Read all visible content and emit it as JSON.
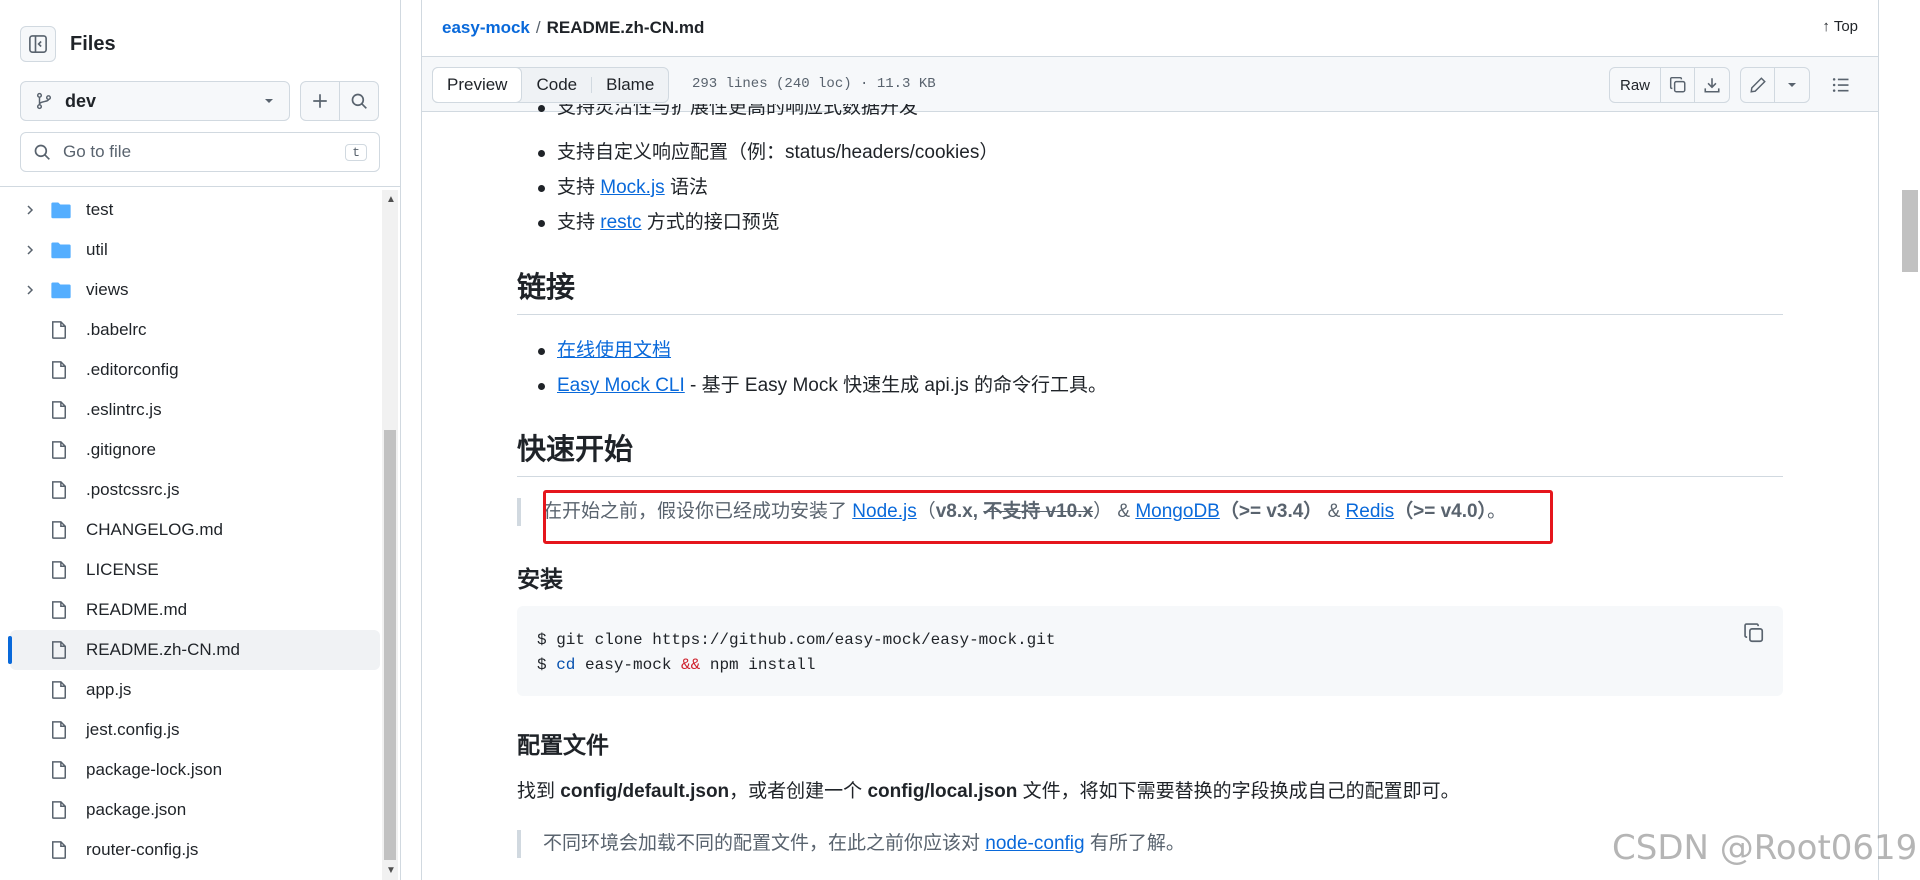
{
  "sidebar": {
    "title": "Files",
    "branch": "dev",
    "goto_placeholder": "Go to file",
    "goto_shortcut": "t",
    "folders": [
      {
        "label": "test"
      },
      {
        "label": "util"
      },
      {
        "label": "views"
      }
    ],
    "files": [
      {
        "label": ".babelrc"
      },
      {
        "label": ".editorconfig"
      },
      {
        "label": ".eslintrc.js"
      },
      {
        "label": ".gitignore"
      },
      {
        "label": ".postcssrc.js"
      },
      {
        "label": "CHANGELOG.md"
      },
      {
        "label": "LICENSE"
      },
      {
        "label": "README.md"
      },
      {
        "label": "README.zh-CN.md",
        "active": true
      },
      {
        "label": "app.js"
      },
      {
        "label": "jest.config.js"
      },
      {
        "label": "package-lock.json"
      },
      {
        "label": "package.json"
      },
      {
        "label": "router-config.js"
      }
    ]
  },
  "header": {
    "repo": "easy-mock",
    "separator": "/",
    "file": "README.zh-CN.md",
    "top_label": "Top"
  },
  "toolbar": {
    "tabs": [
      "Preview",
      "Code",
      "Blame"
    ],
    "selected_tab": "Preview",
    "meta": "293 lines (240 loc) · 11.3 KB",
    "raw_label": "Raw"
  },
  "content": {
    "feature_partial": "支持灵活性与扩展性更高的响应式数据开发",
    "feature_custom_response": "支持自定义响应配置（例：status/headers/cookies）",
    "feature_mockjs": {
      "prefix": "支持 ",
      "link": "Mock.js",
      "suffix": " 语法"
    },
    "feature_restc": {
      "prefix": "支持 ",
      "link": "restc",
      "suffix": " 方式的接口预览"
    },
    "links_heading": "链接",
    "links": [
      {
        "link": "在线使用文档",
        "suffix": ""
      },
      {
        "link": "Easy Mock CLI",
        "suffix": " - 基于 Easy Mock 快速生成 api.js 的命令行工具。"
      }
    ],
    "quickstart_heading": "快速开始",
    "prereq": {
      "intro": "在开始之前，假设你已经成功安装了 ",
      "node_link": "Node.js",
      "node_ver_open": "（",
      "node_ver": "v8.x, ",
      "node_unsupported": "不支持 v10.x",
      "node_ver_close": "）",
      "amp1": " & ",
      "mongo_link": "MongoDB",
      "mongo_ver": "（>= v3.4）",
      "amp2": " & ",
      "redis_link": "Redis",
      "redis_ver": "（>= v4.0）",
      "end": "。"
    },
    "install_heading": "安装",
    "code": {
      "line1": "$ git clone https://github.com/easy-mock/easy-mock.git",
      "line2_prompt": "$ ",
      "line2_cmd": "cd",
      "line2_mid": " easy-mock ",
      "line2_op": "&&",
      "line2_end": " npm install"
    },
    "config_heading": "配置文件",
    "config_para": {
      "p1": "找到 ",
      "b1": "config/default.json",
      "p2": "，或者创建一个 ",
      "b2": "config/local.json",
      "p3": " 文件，将如下需要替换的字段换成自己的配置即可。"
    },
    "config_note": {
      "prefix": "不同环境会加载不同的配置文件，在此之前你应该对 ",
      "link": "node-config",
      "suffix": " 有所了解。"
    }
  },
  "watermark": "CSDN @Root0619",
  "colors": {
    "accent": "#0969da",
    "highlight": "#e5161c",
    "border": "#d1d9e0"
  }
}
